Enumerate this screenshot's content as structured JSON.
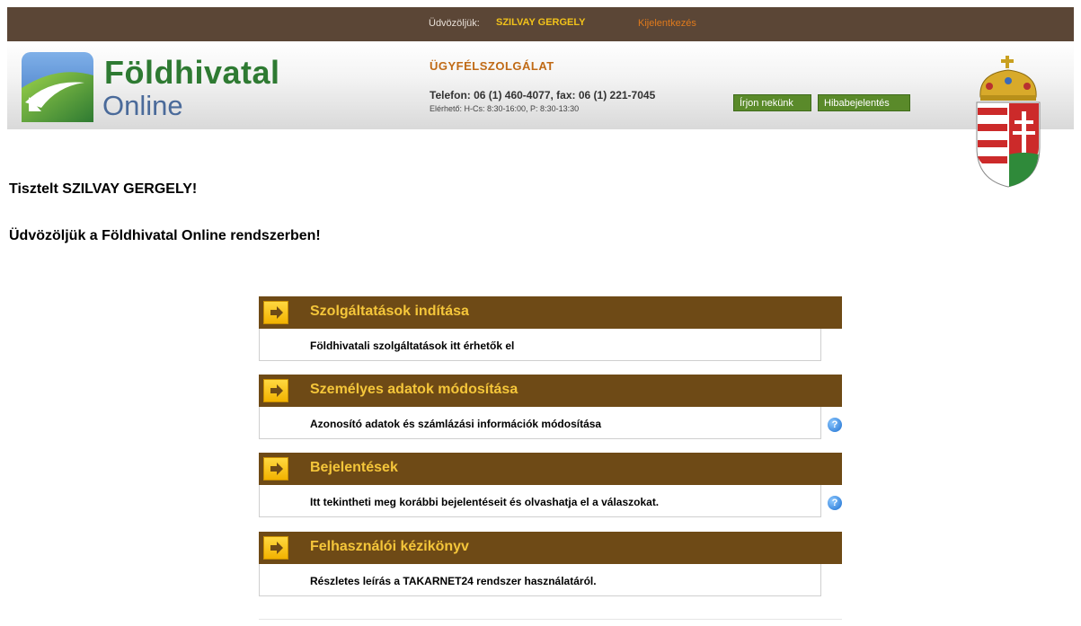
{
  "topbar": {
    "greeting": "Üdvözöljük:",
    "user": "SZILVAY GERGELY",
    "logout": "Kijelentkezés"
  },
  "header": {
    "logo_line1": "Földhivatal",
    "logo_line2": "Online",
    "service_title": "ÜGYFÉLSZOLGÁLAT",
    "phone": "Telefon: 06 (1) 460-4077, fax: 06 (1) 221-7045",
    "hours": "Elérhető: H-Cs: 8:30-16:00, P: 8:30-13:30",
    "write_us": "Írjon nekünk",
    "report_bug": "Hibabejelentés"
  },
  "greeting": {
    "line1": "Tisztelt SZILVAY GERGELY!",
    "line2": "Üdvözöljük a Földhivatal Online rendszerben!"
  },
  "menu": [
    {
      "title": "Szolgáltatások indítása",
      "desc": "Földhivatali szolgáltatások itt érhetők el",
      "help": false
    },
    {
      "title": "Személyes adatok módosítása",
      "desc": "Azonosító adatok és számlázási információk módosítása",
      "help": true
    },
    {
      "title": "Bejelentések",
      "desc": "Itt tekintheti meg korábbi bejelentéseit és olvashatja el a válaszokat.",
      "help": true
    },
    {
      "title": "Felhasználói kézikönyv",
      "desc": "Részletes leírás a TAKARNET24 rendszer használatáról.",
      "help": false
    }
  ],
  "colors": {
    "topbar": "#5b4636",
    "menu_bar": "#6e4a16",
    "menu_title": "#f5c63a",
    "user_highlight": "#f2c21a",
    "logout": "#e07a1c",
    "logo_green": "#2e7a32",
    "button_green": "#5a8a2a"
  }
}
